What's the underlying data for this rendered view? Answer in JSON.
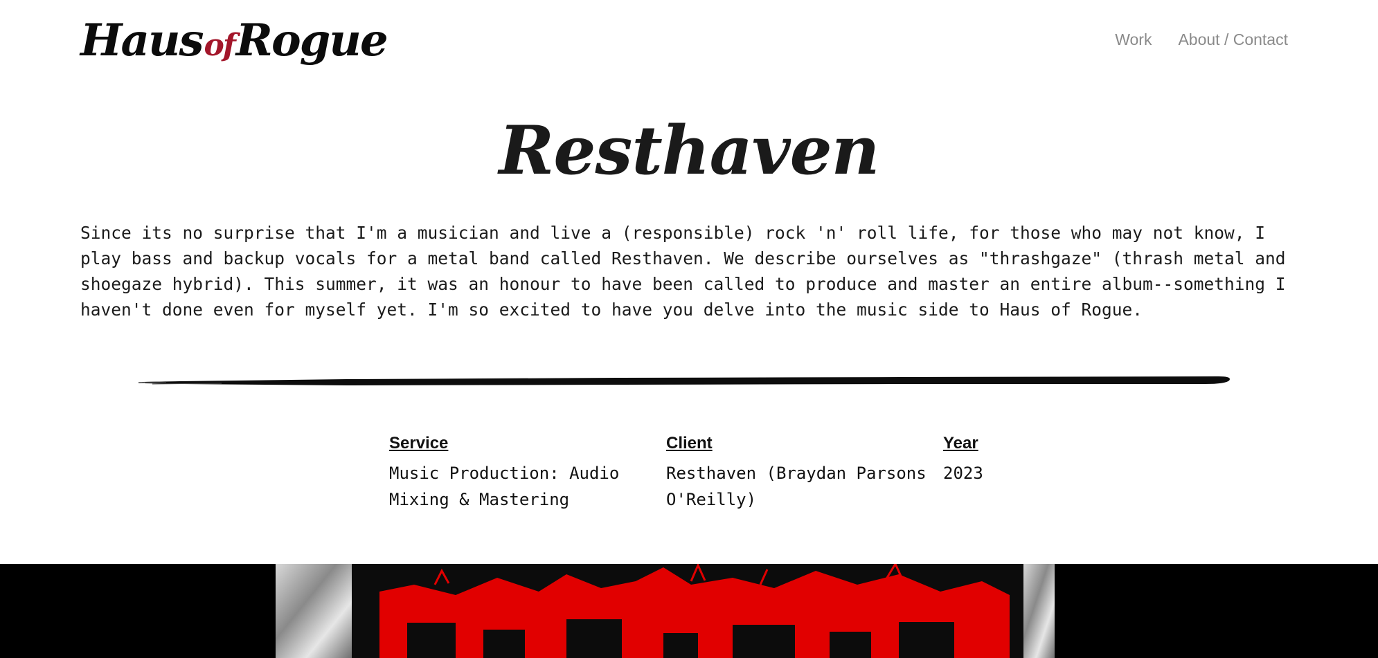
{
  "header": {
    "logo_text_1": "Haus",
    "logo_text_2": "of",
    "logo_text_3": "Rogue",
    "nav": [
      "Work",
      "About / Contact"
    ]
  },
  "project": {
    "title": "Resthaven",
    "intro": "Since its no surprise that I'm a musician and live a (responsible) rock 'n' roll life, for those who may not know, I play bass and backup vocals for a metal band called Resthaven. We describe ourselves as \"thrashgaze\" (thrash metal and shoegaze hybrid). This summer, it was an honour to have been called to produce and master an entire album--something I haven't done even for myself yet. I'm so excited to have you delve into the music side to Haus of Rogue."
  },
  "meta": {
    "service_label": "Service",
    "service_value": "Music Production: Audio Mixing & Mastering",
    "client_label": "Client",
    "client_value": "Resthaven (Braydan Parsons O'Reilly)",
    "year_label": "Year",
    "year_value": "2023"
  },
  "colors": {
    "accent_red": "#d40000",
    "logo_lip": "#a3162a"
  }
}
